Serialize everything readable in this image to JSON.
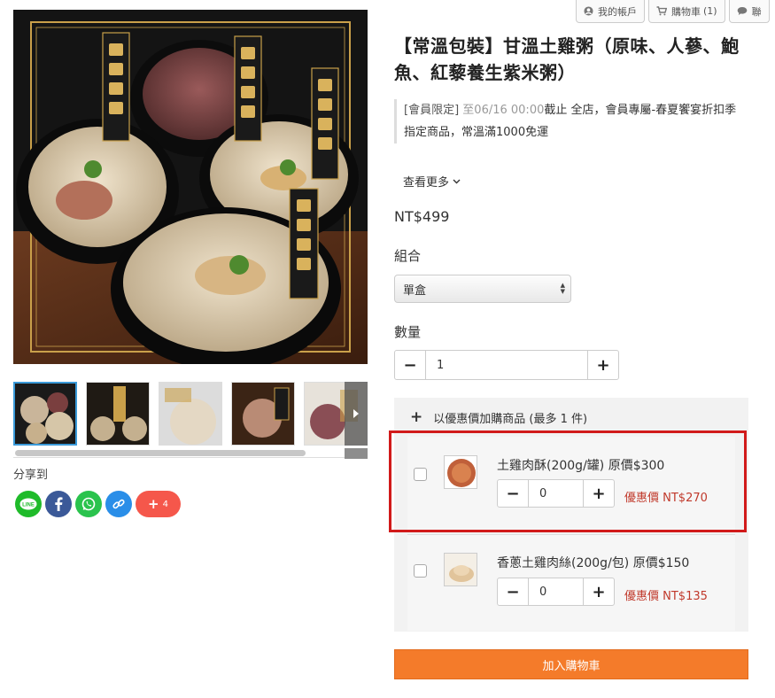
{
  "top_nav": {
    "account": "我的帳戶",
    "cart": "購物車",
    "cart_count": "(1)",
    "contact": "聯"
  },
  "gallery": {
    "main_image_alt": "",
    "thumbnail_count": 5
  },
  "share": {
    "label": "分享到",
    "plus_count": "4"
  },
  "product": {
    "title": "【常溫包裝】甘溫土雞粥（原味、人蔘、鮑魚、紅藜養生紫米粥）",
    "promo_tag": "[會員限定]",
    "promo_date": "至06/16 00:00",
    "promo_text": "截止 全店，會員專屬-春夏饗宴折扣季",
    "promo_line2": "指定商品，常溫滿1000免運",
    "see_more": "查看更多",
    "price": "NT$499",
    "option_label": "組合",
    "option_selected": "單盒",
    "qty_label": "數量",
    "qty_value": "1"
  },
  "addon": {
    "header": "以優惠價加購商品 (最多 1 件)",
    "items": [
      {
        "name": "土雞肉酥(200g/罐) 原價$300",
        "qty": "0",
        "sale": "優惠價 NT$270"
      },
      {
        "name": "香蔥土雞肉絲(200g/包) 原價$150",
        "qty": "0",
        "sale": "優惠價 NT$135"
      }
    ]
  },
  "add_to_cart": "加入購物車",
  "colors": {
    "accent_orange": "#f47b2a",
    "sale_red": "#c0392b",
    "highlight_red": "#d11a1a"
  }
}
